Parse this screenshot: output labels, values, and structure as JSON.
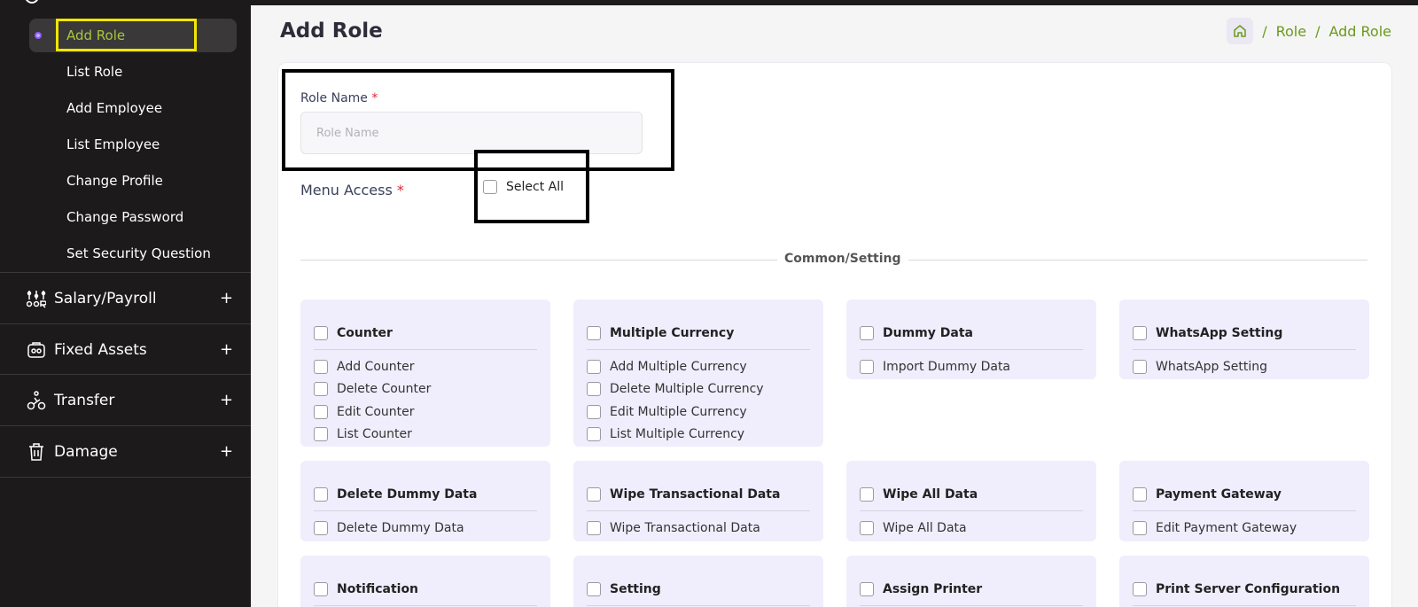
{
  "sidebar": {
    "sub_items": [
      "Add Role",
      "List Role",
      "Add Employee",
      "List Employee",
      "Change Profile",
      "Change Password",
      "Set Security Question"
    ],
    "groups": [
      {
        "label": "Salary/Payroll",
        "icon": "payroll-icon"
      },
      {
        "label": "Fixed Assets",
        "icon": "assets-icon"
      },
      {
        "label": "Transfer",
        "icon": "transfer-icon"
      },
      {
        "label": "Damage",
        "icon": "trash-icon"
      }
    ],
    "expand_symbol": "+"
  },
  "page": {
    "title": "Add Role",
    "breadcrumb": [
      "Role",
      "Add Role"
    ],
    "breadcrumb_sep": "/"
  },
  "form": {
    "role_name_label": "Role Name",
    "role_name_placeholder": "Role Name",
    "role_name_value": "",
    "menu_access_label": "Menu Access",
    "required_mark": "*",
    "select_all_label": "Select All",
    "section_title": "Common/Setting"
  },
  "permissions": [
    {
      "title": "Counter",
      "items": [
        "Add Counter",
        "Delete Counter",
        "Edit Counter",
        "List Counter"
      ]
    },
    {
      "title": "Multiple Currency",
      "items": [
        "Add Multiple Currency",
        "Delete Multiple Currency",
        "Edit Multiple Currency",
        "List Multiple Currency"
      ]
    },
    {
      "title": "Dummy Data",
      "items": [
        "Import Dummy Data"
      ]
    },
    {
      "title": "WhatsApp Setting",
      "items": [
        "WhatsApp Setting"
      ]
    },
    {
      "title": "Delete Dummy Data",
      "items": [
        "Delete Dummy Data"
      ]
    },
    {
      "title": "Wipe Transactional Data",
      "items": [
        "Wipe Transactional Data"
      ]
    },
    {
      "title": "Wipe All Data",
      "items": [
        "Wipe All Data"
      ]
    },
    {
      "title": "Payment Gateway",
      "items": [
        "Edit Payment Gateway"
      ]
    },
    {
      "title": "Notification",
      "items": []
    },
    {
      "title": "Setting",
      "items": []
    },
    {
      "title": "Assign Printer",
      "items": []
    },
    {
      "title": "Print Server Configuration",
      "items": []
    }
  ],
  "colors": {
    "sidebar_bg": "#1c1a1b",
    "accent_green": "#a6c83a",
    "breadcrumb_green": "#6a9a1a",
    "perm_bg": "#f0edfc",
    "required_red": "#e0262e",
    "highlight_yellow": "#f2e600"
  }
}
